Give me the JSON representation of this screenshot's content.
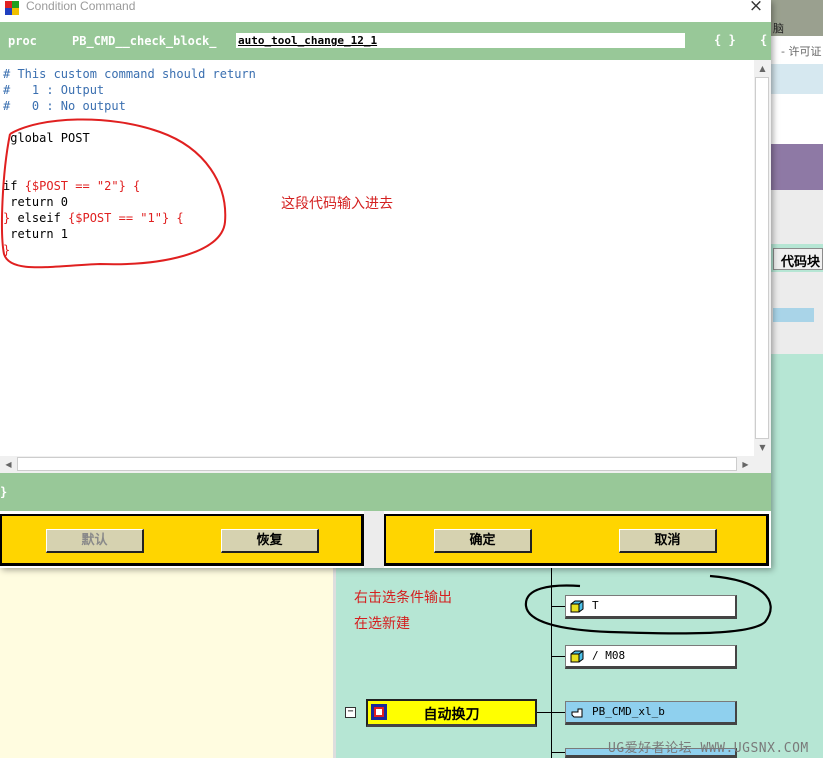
{
  "dialog": {
    "title": "Condition Command",
    "close_glyph": "×",
    "proc_keyword": "proc",
    "proc_prefix": "PB_CMD__check_block_",
    "proc_name": "auto_tool_change_12_1",
    "proc_braces": "{ }",
    "proc_open_brace": "{",
    "code_lines": {
      "l1": "# This custom command should return",
      "l2": "#   1 : Output",
      "l3": "#   0 : No output",
      "l4": " global POST",
      "l5_a": "if ",
      "l5_b": "{$POST == \"2\"} {",
      "l6": " return 0",
      "l7_a": "} ",
      "l7_b": "elseif ",
      "l7_c": "{$POST == \"1\"} {",
      "l8": " return 1",
      "l9": "}"
    },
    "closing_brace": "}",
    "buttons": {
      "default_label": "默认",
      "restore_label": "恢复",
      "ok_label": "确定",
      "cancel_label": "取消"
    }
  },
  "annotations": {
    "code_note": "这段代码输入进去",
    "right_click_note_1": "右击选条件输出",
    "right_click_note_2": "在选新建"
  },
  "background": {
    "top_corner_text": "脑",
    "license_text": "- 许可证",
    "code_block_button": "代码块",
    "tree": {
      "node_t": "T",
      "node_m08": "/ M08",
      "folder_label": "自动换刀",
      "collapse_glyph": "−",
      "node_cmd": "PB_CMD_xl_b"
    },
    "watermark": "UG爱好者论坛 WWW.UGSNX.COM"
  },
  "colors": {
    "green_bar": "#98c898",
    "button_panel": "#ffd500",
    "comment_blue": "#3a6fb0",
    "code_red": "#e02020",
    "annotation_red": "#d42020",
    "canvas_teal": "#b6e6d4"
  }
}
